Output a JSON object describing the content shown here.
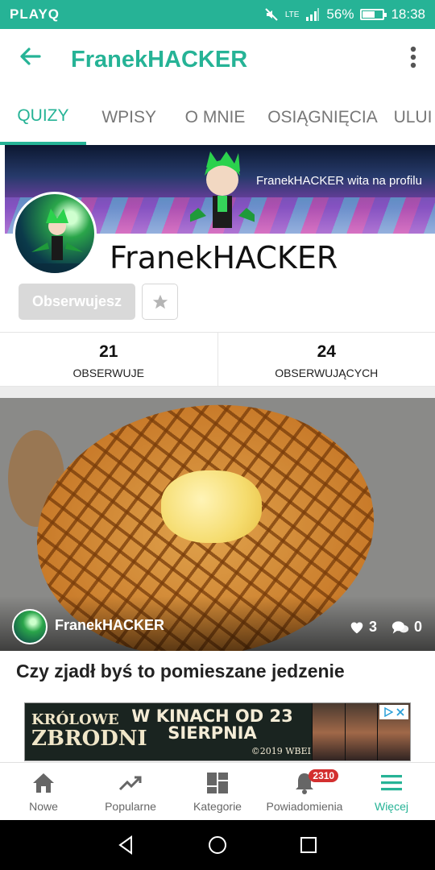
{
  "status_bar": {
    "carrier": "PLAYQ",
    "battery": "56%",
    "time": "18:38",
    "network": "LTE"
  },
  "appbar": {
    "title": "FranekHACKER"
  },
  "tabs": [
    {
      "label": "QUIZY"
    },
    {
      "label": "WPISY"
    },
    {
      "label": "O MNIE"
    },
    {
      "label": "OSIĄGNIĘCIA"
    },
    {
      "label": "ULUI"
    }
  ],
  "banner": {
    "caption": "FranekHACKER wita na profilu"
  },
  "profile": {
    "name": "FranekHACKER",
    "follow_label": "Obserwujesz"
  },
  "stats": [
    {
      "value": "21",
      "label": "OBSERWUJE"
    },
    {
      "value": "24",
      "label": "OBSERWUJĄCYCH"
    }
  ],
  "card": {
    "author": "FranekHACKER",
    "likes": "3",
    "comments": "0",
    "title": "Czy zjadł byś to pomieszane jedzenie"
  },
  "ad": {
    "line1": "KRÓLOWE",
    "line2": "ZBRODNI",
    "promo": "W KINACH OD 23 SIERPNIA",
    "copyright": "©2019 WBEI"
  },
  "bottom_nav": [
    {
      "label": "Nowe"
    },
    {
      "label": "Popularne"
    },
    {
      "label": "Kategorie"
    },
    {
      "label": "Powiadomienia",
      "badge": "2310"
    },
    {
      "label": "Więcej"
    }
  ],
  "colors": {
    "accent": "#26b396",
    "badge": "#d32f2f"
  }
}
